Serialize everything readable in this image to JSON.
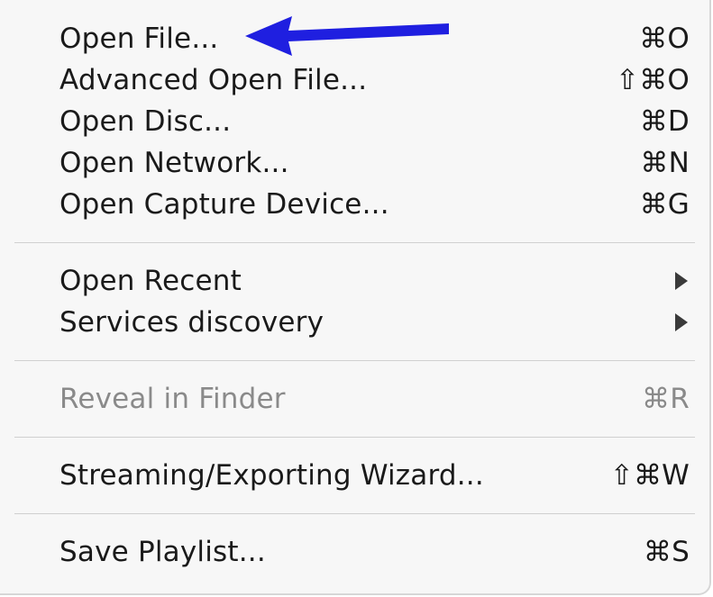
{
  "menu": {
    "groups": [
      {
        "items": [
          {
            "label": "Open File...",
            "shortcut": "⌘O"
          },
          {
            "label": "Advanced Open File...",
            "shortcut": "⇧⌘O"
          },
          {
            "label": "Open Disc...",
            "shortcut": "⌘D"
          },
          {
            "label": "Open Network...",
            "shortcut": "⌘N"
          },
          {
            "label": "Open Capture Device...",
            "shortcut": "⌘G"
          }
        ]
      },
      {
        "items": [
          {
            "label": "Open Recent",
            "submenu": true
          },
          {
            "label": "Services discovery",
            "submenu": true
          }
        ]
      },
      {
        "items": [
          {
            "label": "Reveal in Finder",
            "shortcut": "⌘R",
            "disabled": true
          }
        ]
      },
      {
        "items": [
          {
            "label": "Streaming/Exporting Wizard...",
            "shortcut": "⇧⌘W"
          }
        ]
      },
      {
        "items": [
          {
            "label": "Save Playlist...",
            "shortcut": "⌘S"
          }
        ]
      }
    ]
  },
  "annotation": {
    "arrow_color": "#1f1fe0",
    "icon": "arrow-left-icon"
  },
  "colors": {
    "menu_background": "#f7f7f7",
    "text": "#1a1a1a",
    "disabled_text": "#8a8a8a",
    "separator": "#d0d0d0"
  }
}
